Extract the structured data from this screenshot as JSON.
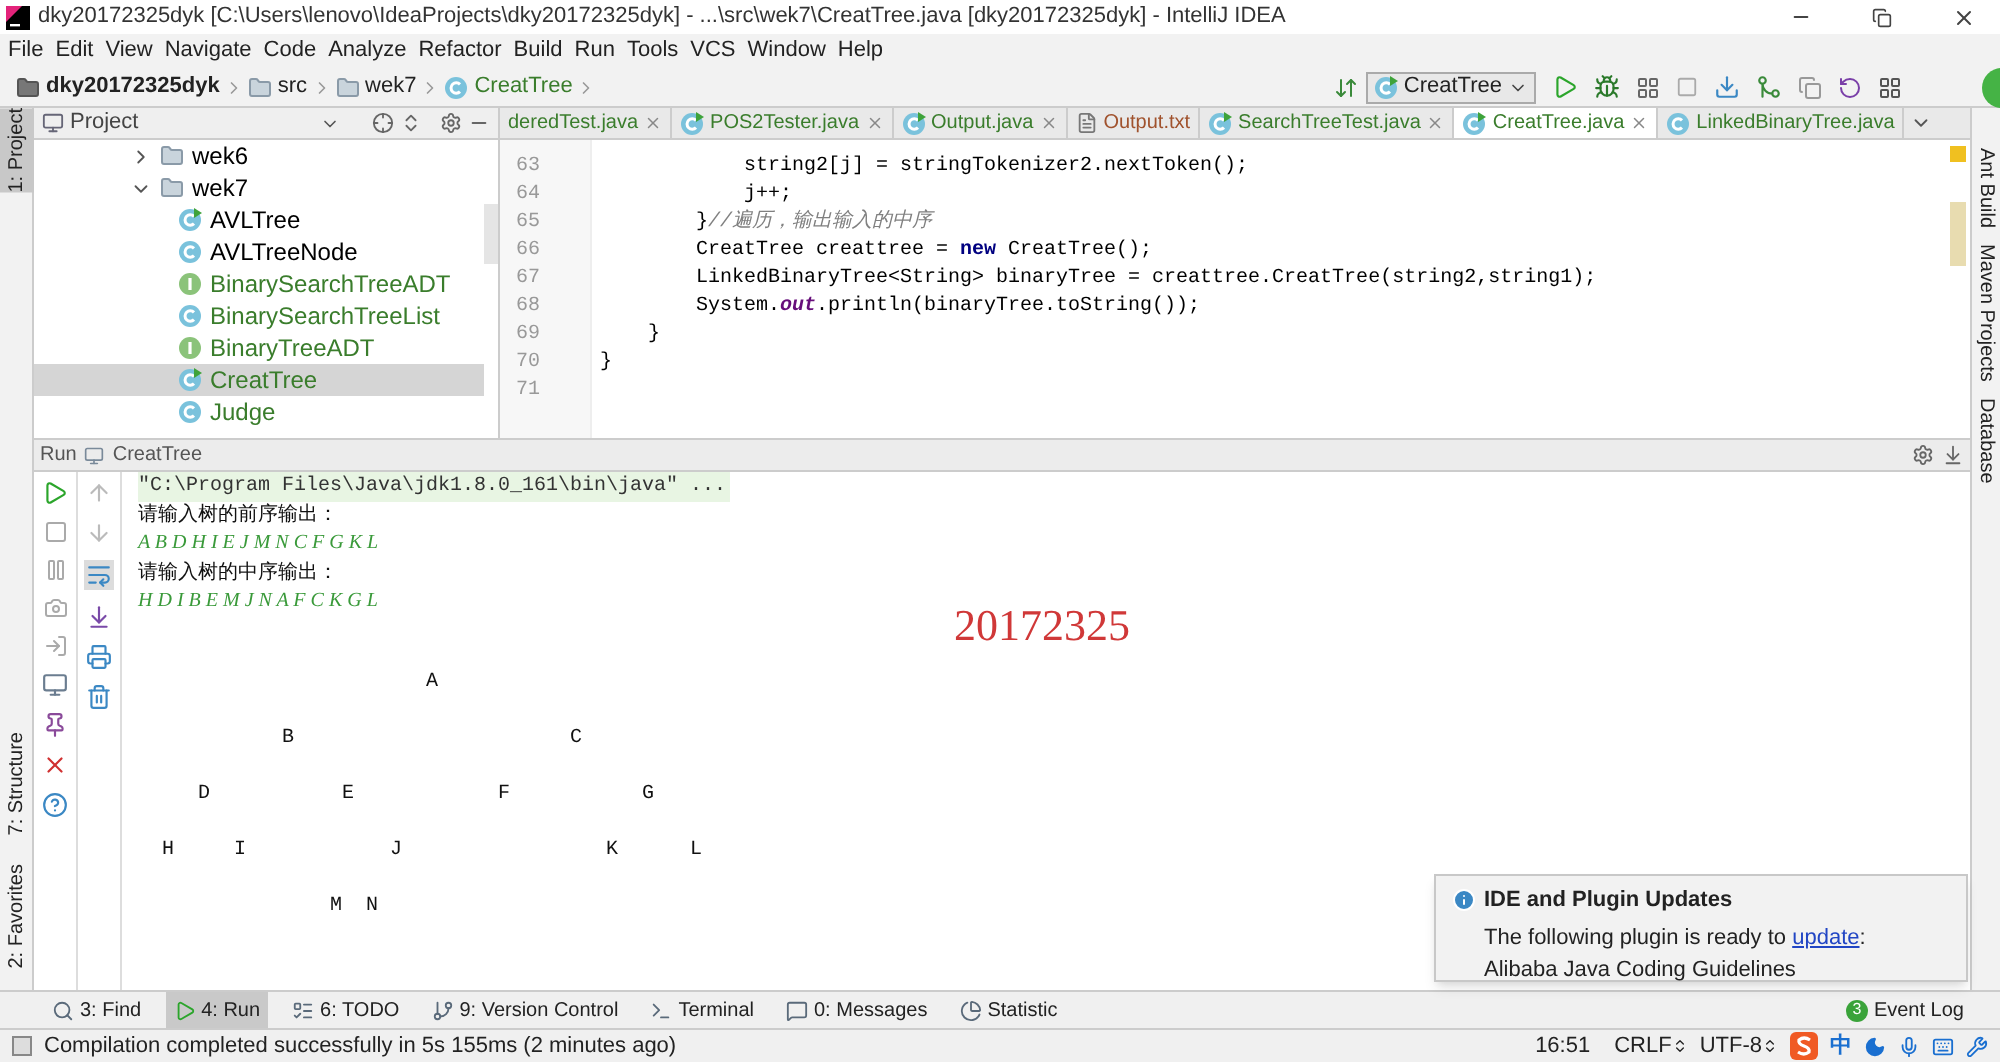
{
  "window": {
    "title": "dky20172325dyk [C:\\Users\\lenovo\\IdeaProjects\\dky20172325dyk] - ...\\src\\wek7\\CreatTree.java [dky20172325dyk] - IntelliJ IDEA"
  },
  "menu": [
    "File",
    "Edit",
    "View",
    "Navigate",
    "Code",
    "Analyze",
    "Refactor",
    "Build",
    "Run",
    "Tools",
    "VCS",
    "Window",
    "Help"
  ],
  "breadcrumbs": [
    {
      "label": "dky20172325dyk",
      "kind": "project"
    },
    {
      "label": "src",
      "kind": "folder"
    },
    {
      "label": "wek7",
      "kind": "folder"
    },
    {
      "label": "CreatTree",
      "kind": "class"
    }
  ],
  "run_config": "CreatTree",
  "left_stripe": [
    {
      "label": "1: Project",
      "selected": true
    },
    {
      "label": "7: Structure",
      "selected": false
    },
    {
      "label": "2: Favorites",
      "selected": false
    }
  ],
  "right_stripe": [
    "Ant Build",
    "Maven Projects",
    "Database"
  ],
  "project": {
    "title": "Project",
    "tree": [
      {
        "label": "wek6",
        "kind": "folder",
        "expanded": false,
        "selected": false,
        "color": "#000000"
      },
      {
        "label": "wek7",
        "kind": "folder",
        "expanded": true,
        "selected": false,
        "color": "#000000",
        "children": [
          {
            "label": "AVLTree",
            "kind": "runnable",
            "selected": false,
            "color": "#000000"
          },
          {
            "label": "AVLTreeNode",
            "kind": "class",
            "selected": false,
            "color": "#000000"
          },
          {
            "label": "BinarySearchTreeADT",
            "kind": "interface",
            "selected": false,
            "color": "#3a7d2c"
          },
          {
            "label": "BinarySearchTreeList",
            "kind": "class",
            "selected": false,
            "color": "#3a7d2c"
          },
          {
            "label": "BinaryTreeADT",
            "kind": "interface",
            "selected": false,
            "color": "#3a7d2c"
          },
          {
            "label": "CreatTree",
            "kind": "runnable",
            "selected": true,
            "color": "#3a7d2c"
          },
          {
            "label": "Judge",
            "kind": "class",
            "selected": false,
            "color": "#3a7d2c"
          }
        ]
      }
    ]
  },
  "editor_tabs": [
    {
      "label": "deredTest.java",
      "kind": "none",
      "color": "#3a7d2c",
      "selected": false,
      "closable": true
    },
    {
      "label": "POS2Tester.java",
      "kind": "runnable",
      "color": "#3a7d2c",
      "selected": false,
      "closable": true
    },
    {
      "label": "Output.java",
      "kind": "runnable",
      "color": "#3a7d2c",
      "selected": false,
      "closable": true
    },
    {
      "label": "Output.txt",
      "kind": "text",
      "color": "#a0522d",
      "selected": false,
      "closable": false
    },
    {
      "label": "SearchTreeTest.java",
      "kind": "runnable",
      "color": "#3a7d2c",
      "selected": false,
      "closable": true
    },
    {
      "label": "CreatTree.java",
      "kind": "runnable",
      "color": "#3a7d2c",
      "selected": true,
      "closable": true
    },
    {
      "label": "LinkedBinaryTree.java",
      "kind": "class",
      "color": "#3a7d2c",
      "selected": false,
      "closable": false
    }
  ],
  "code": [
    {
      "number": "63",
      "segments": [
        {
          "kind": "plain",
          "text": "            string2[j] = stringTokenizer2.nextToken();"
        }
      ]
    },
    {
      "number": "64",
      "segments": [
        {
          "kind": "plain",
          "text": "            j++;"
        }
      ]
    },
    {
      "number": "65",
      "segments": [
        {
          "kind": "plain",
          "text": "        }"
        },
        {
          "kind": "comment",
          "text": "//遍历，输出输入的中序"
        }
      ]
    },
    {
      "number": "66",
      "segments": [
        {
          "kind": "plain",
          "text": "        CreatTree creattree = "
        },
        {
          "kind": "keyword",
          "text": "new"
        },
        {
          "kind": "plain",
          "text": " CreatTree();"
        }
      ]
    },
    {
      "number": "67",
      "segments": [
        {
          "kind": "plain",
          "text": "        LinkedBinaryTree<String> binaryTree = creattree.CreatTree(string2,string1);"
        }
      ]
    },
    {
      "number": "68",
      "segments": [
        {
          "kind": "plain",
          "text": "        System."
        },
        {
          "kind": "field",
          "text": "out"
        },
        {
          "kind": "plain",
          "text": ".println(binaryTree.toString());"
        }
      ]
    },
    {
      "number": "69",
      "segments": [
        {
          "kind": "plain",
          "text": "    }"
        }
      ]
    },
    {
      "number": "70",
      "segments": [
        {
          "kind": "plain",
          "text": "}"
        }
      ]
    },
    {
      "number": "71"
    }
  ],
  "run": {
    "title": "Run",
    "config": "CreatTree",
    "console": [
      {
        "kind": "command",
        "text": "\"C:\\Program Files\\Java\\jdk1.8.0_161\\bin\\java\" ..."
      },
      {
        "kind": "prompt",
        "text": "请输入树的前序输出："
      },
      {
        "kind": "input",
        "text": "A B D H I E J M N C F G K L"
      },
      {
        "kind": "prompt",
        "text": "请输入树的中序输出："
      },
      {
        "kind": "input",
        "text": "H D I B E M J N A F C K G L"
      }
    ],
    "tree_rows": [
      "                        A",
      "            B                       C",
      "     D           E            F           G",
      "  H     I            J                 K      L",
      "                M  N"
    ],
    "annotation": "20172325"
  },
  "notification": {
    "title": "IDE and Plugin Updates",
    "prefix": "The following plugin is ready to ",
    "link": "update",
    "suffix": ":",
    "detail": "Alibaba Java Coding Guidelines"
  },
  "tool_tabs": [
    {
      "label": "3: Find",
      "kind": "find",
      "selected": false
    },
    {
      "label": "4: Run",
      "kind": "run",
      "selected": true
    },
    {
      "label": "6: TODO",
      "kind": "todo",
      "selected": false
    },
    {
      "label": "9: Version Control",
      "kind": "vcs",
      "selected": false
    },
    {
      "label": "Terminal",
      "kind": "terminal",
      "selected": false
    },
    {
      "label": "0: Messages",
      "kind": "messages",
      "selected": false
    },
    {
      "label": "Statistic",
      "kind": "statistic",
      "selected": false
    }
  ],
  "event_log": {
    "label": "Event Log",
    "count": "3"
  },
  "status": {
    "message": "Compilation completed successfully in 5s 155ms (2 minutes ago)",
    "time": "16:51",
    "line_separator": "CRLF",
    "encoding": "UTF-8",
    "ime": "中"
  }
}
